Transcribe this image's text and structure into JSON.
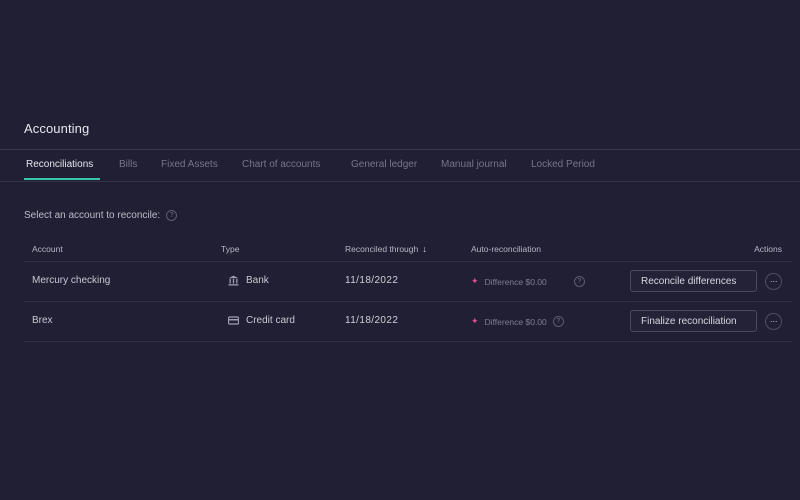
{
  "page": {
    "title": "Accounting"
  },
  "tabs": [
    {
      "label": "Reconciliations",
      "active": true
    },
    {
      "label": "Bills"
    },
    {
      "label": "Fixed Assets"
    },
    {
      "label": "Chart of accounts"
    },
    {
      "label": "General ledger"
    },
    {
      "label": "Manual journal"
    },
    {
      "label": "Locked Period"
    }
  ],
  "prompt": {
    "text": "Select an account to reconcile:",
    "help_icon": "?"
  },
  "table": {
    "headers": {
      "account": "Account",
      "type": "Type",
      "reconciled": "Reconciled through",
      "sort_icon": "↓",
      "auto": "Auto-reconciliation",
      "actions": "Actions"
    },
    "rows": [
      {
        "account": "Mercury checking",
        "type": "Bank",
        "type_icon": "bank-icon",
        "reconciled": "11/18/2022",
        "auto_icon": "✦",
        "auto": "Difference $0.00",
        "help_icon": "?",
        "action": "Reconcile differences",
        "more": "···"
      },
      {
        "account": "Brex",
        "type": "Credit card",
        "type_icon": "credit-card-icon",
        "reconciled": "11/18/2022",
        "auto_icon": "✦",
        "auto": "Difference $0.00",
        "help_icon": "?",
        "action": "Finalize reconciliation",
        "more": "···"
      }
    ]
  },
  "colors": {
    "background": "#201f33",
    "accent_tab_underline": "#35c7a8",
    "auto_reconcile_icon": "#e24e8d"
  }
}
